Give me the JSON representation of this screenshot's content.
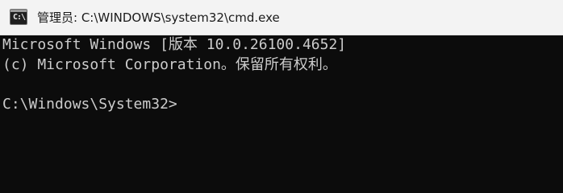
{
  "window": {
    "title": "管理员: C:\\WINDOWS\\system32\\cmd.exe",
    "icon": "cmd-icon",
    "icon_glyph": "C:\\"
  },
  "console": {
    "lines": [
      "Microsoft Windows [版本 10.0.26100.4652]",
      "(c) Microsoft Corporation。保留所有权利。",
      "C:\\Windows\\System32>"
    ],
    "background_color": "#0c0c0c",
    "text_color": "#cccccc"
  }
}
